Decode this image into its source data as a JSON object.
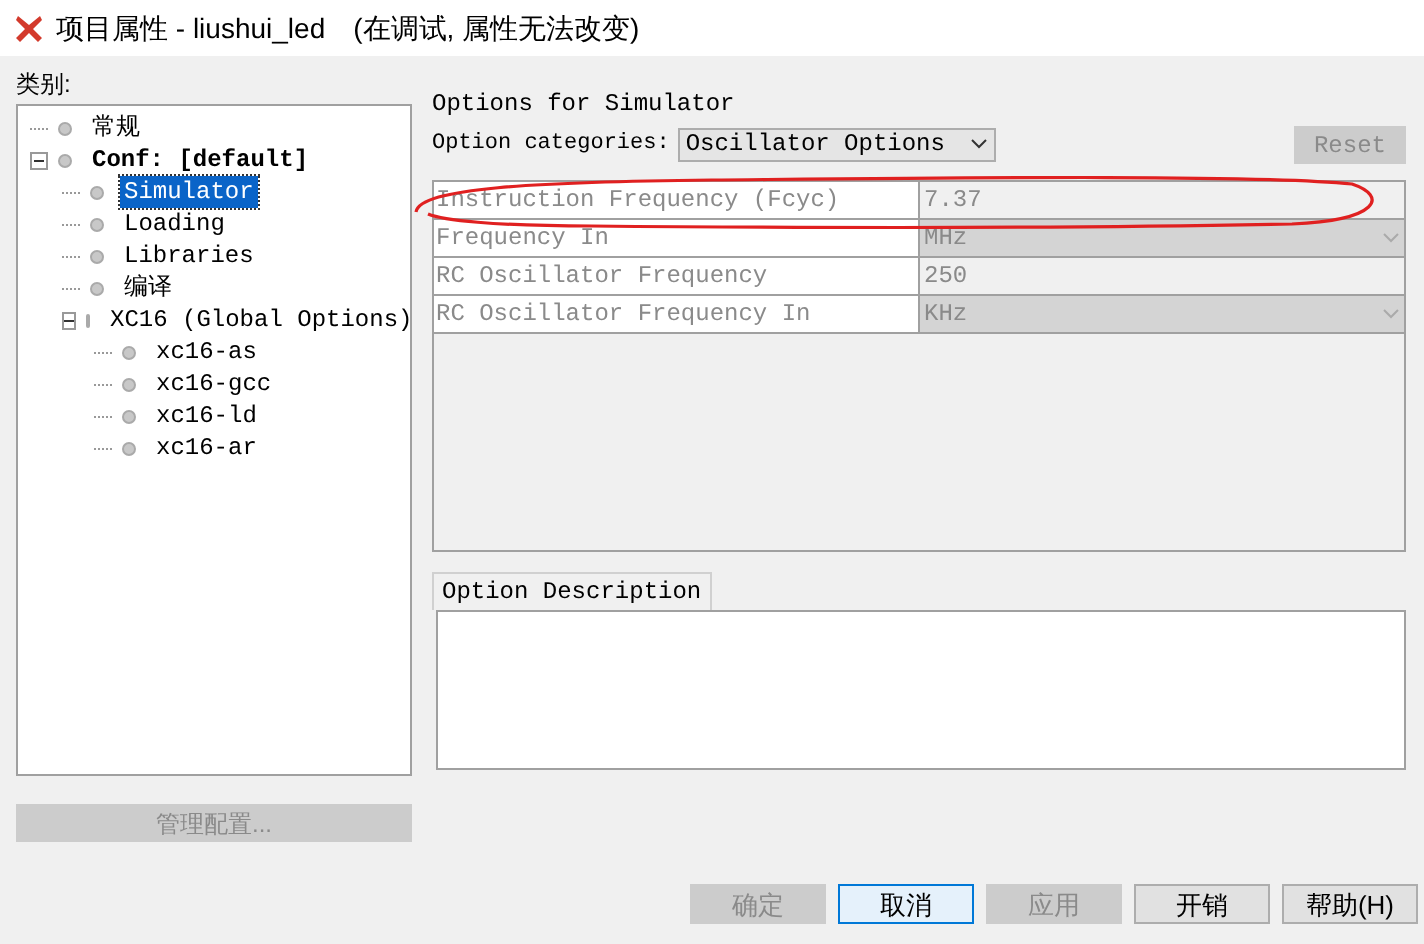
{
  "window": {
    "title": "项目属性 - liushui_led",
    "subtitle": "(在调试, 属性无法改变)"
  },
  "categories": {
    "label": "类别:",
    "tree": [
      {
        "label": "常规",
        "bold": false,
        "selected": false
      },
      {
        "label": "Conf: [default]",
        "bold": true,
        "selected": false,
        "expanded": true,
        "children": [
          {
            "label": "Simulator",
            "bold": false,
            "selected": true
          },
          {
            "label": "Loading",
            "bold": false,
            "selected": false
          },
          {
            "label": "Libraries",
            "bold": false,
            "selected": false
          },
          {
            "label": "编译",
            "bold": false,
            "selected": false
          },
          {
            "label": "XC16 (Global Options)",
            "bold": false,
            "selected": false,
            "expanded": true,
            "children": [
              {
                "label": "xc16-as",
                "bold": false,
                "selected": false
              },
              {
                "label": "xc16-gcc",
                "bold": false,
                "selected": false
              },
              {
                "label": "xc16-ld",
                "bold": false,
                "selected": false
              },
              {
                "label": "xc16-ar",
                "bold": false,
                "selected": false
              }
            ]
          }
        ]
      }
    ]
  },
  "manage_button": {
    "label": "管理配置...",
    "disabled": true
  },
  "options": {
    "title": "Options for Simulator",
    "category_label": "Option categories:",
    "category_value": "Oscillator Options",
    "reset": {
      "label": "Reset",
      "disabled": true
    },
    "rows": [
      {
        "kind": "text",
        "name": "Instruction Frequency (Fcyc)",
        "value": "7.37"
      },
      {
        "kind": "dropdown",
        "name": "Frequency In",
        "value": "MHz"
      },
      {
        "kind": "text",
        "name": "RC Oscillator Frequency",
        "value": "250"
      },
      {
        "kind": "dropdown",
        "name": "RC Oscillator Frequency In",
        "value": "KHz"
      }
    ]
  },
  "description": {
    "tab": "Option Description"
  },
  "buttons": [
    {
      "label": "确定",
      "disabled": true,
      "focused": false
    },
    {
      "label": "取消",
      "disabled": false,
      "focused": true
    },
    {
      "label": "应用",
      "disabled": true,
      "focused": false
    },
    {
      "label": "开销",
      "disabled": false,
      "focused": false
    },
    {
      "label": "帮助(H)",
      "disabled": false,
      "focused": false
    }
  ]
}
